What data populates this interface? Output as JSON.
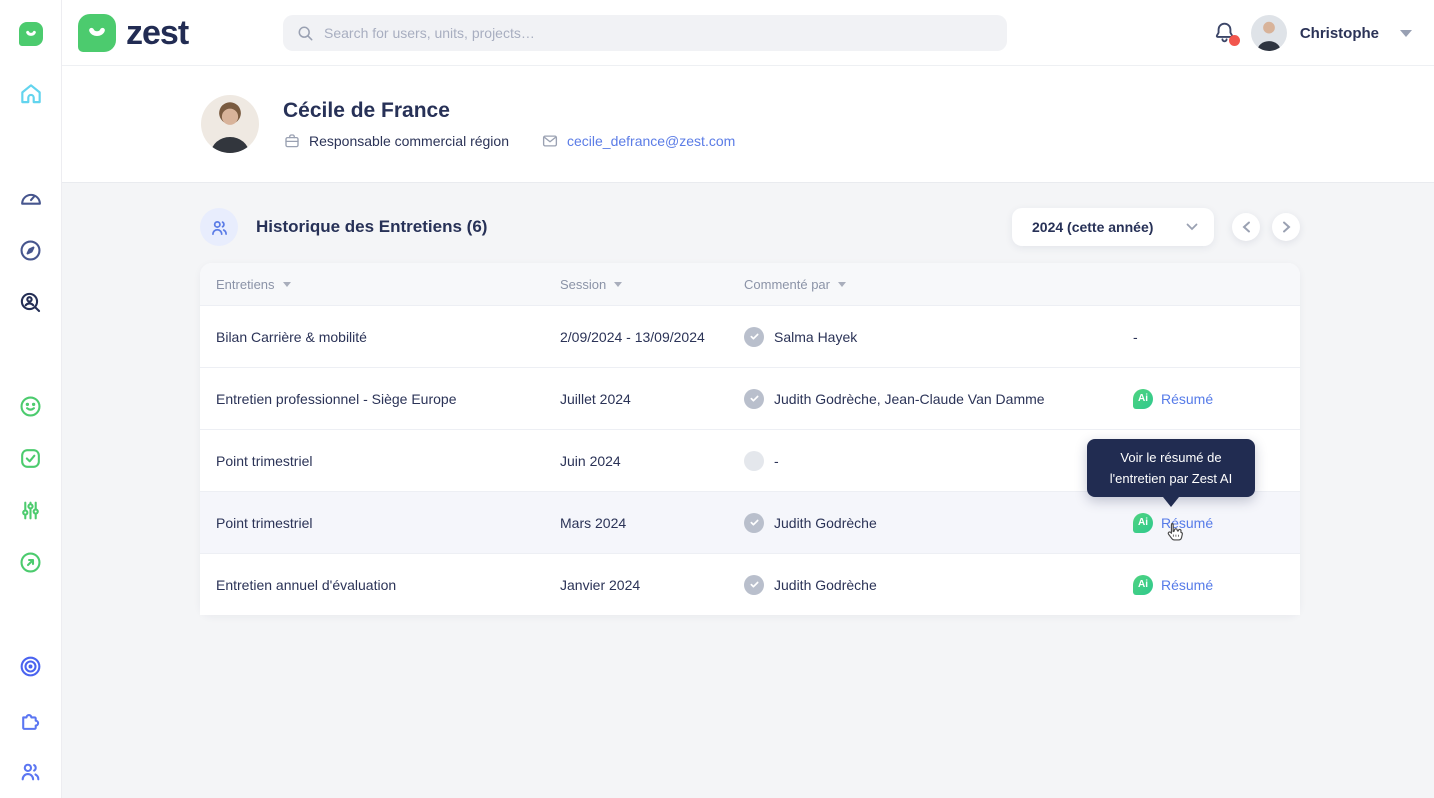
{
  "topbar": {
    "logo_text": "zest",
    "search": {
      "placeholder": "Search for users, units, projects…"
    },
    "user": {
      "name": "Christophe"
    }
  },
  "sidebar": {
    "items": [
      {
        "icon": "zest-mini-logo"
      },
      {
        "icon": "home-icon",
        "active": true
      },
      {
        "icon": "dashboard-gauge-icon"
      },
      {
        "icon": "compass-icon"
      },
      {
        "icon": "user-search-icon"
      },
      {
        "icon": "smiley-icon"
      },
      {
        "icon": "check-square-icon"
      },
      {
        "icon": "sliders-icon"
      },
      {
        "icon": "send-arrow-icon"
      },
      {
        "icon": "target-icon"
      },
      {
        "icon": "puzzle-icon"
      },
      {
        "icon": "users-icon"
      }
    ]
  },
  "profile": {
    "name": "Cécile de France",
    "role": "Responsable commercial région",
    "email": "cecile_defrance@zest.com"
  },
  "history": {
    "title": "Historique des Entretiens (6)",
    "year_filter": "2024 (cette année)",
    "columns": [
      "Entretiens",
      "Session",
      "Commenté par"
    ],
    "ai_badge_label": "Ai",
    "rows": [
      {
        "entretien": "Bilan Carrière & mobilité",
        "session": "2/09/2024 - 13/09/2024",
        "commented_by": "Salma Hayek",
        "summary": "-"
      },
      {
        "entretien": "Entretien professionnel - Siège Europe",
        "session": "Juillet 2024",
        "commented_by": "Judith Godrèche, Jean-Claude Van Damme",
        "summary": "Résumé"
      },
      {
        "entretien": "Point trimestriel",
        "session": "Juin 2024",
        "commented_by": "-",
        "summary": ""
      },
      {
        "entretien": "Point trimestriel",
        "session": "Mars 2024",
        "commented_by": "Judith Godrèche",
        "summary": "Résumé"
      },
      {
        "entretien": "Entretien annuel d'évaluation",
        "session": "Janvier 2024",
        "commented_by": "Judith Godrèche",
        "summary": "Résumé"
      }
    ]
  },
  "tooltip": {
    "line1": "Voir le résumé de",
    "line2": "l'entretien par Zest AI"
  },
  "colors": {
    "brand_green": "#4ccb6e",
    "link_blue": "#567be8",
    "tooltip_navy": "#212c51",
    "notification_red": "#f2564d",
    "accent_cyan": "#62d4ee",
    "accent_blue": "#4a63f0",
    "text_navy": "#2b3357"
  }
}
